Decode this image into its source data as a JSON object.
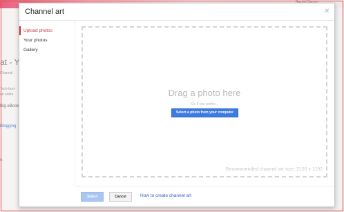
{
  "background": {
    "heading": "at - Yo",
    "subtext": "Channel",
    "line1": "Tech-born",
    "line2": "on entire",
    "line3": "Big eBook",
    "line4": "Blogging",
    "line5": "ls",
    "user": "Rachel Carson"
  },
  "modal": {
    "title": "Channel art",
    "close_icon": "close-icon",
    "sidebar": {
      "items": [
        {
          "label": "Upload photos",
          "active": true
        },
        {
          "label": "Your photos",
          "active": false
        },
        {
          "label": "Gallery",
          "active": false
        }
      ]
    },
    "dropzone": {
      "title": "Drag a photo here",
      "or_text": "Or, if you prefer...",
      "select_button": "Select a photo from your computer",
      "recommended_size": "Recommended channel art size: 2120 x 1192"
    },
    "footer": {
      "select_label": "Select",
      "cancel_label": "Cancel",
      "help_link": "How to create channel art"
    }
  },
  "colors": {
    "accent": "#cc3333",
    "primary_button": "#3d7ae3",
    "link": "#2a61c6"
  }
}
